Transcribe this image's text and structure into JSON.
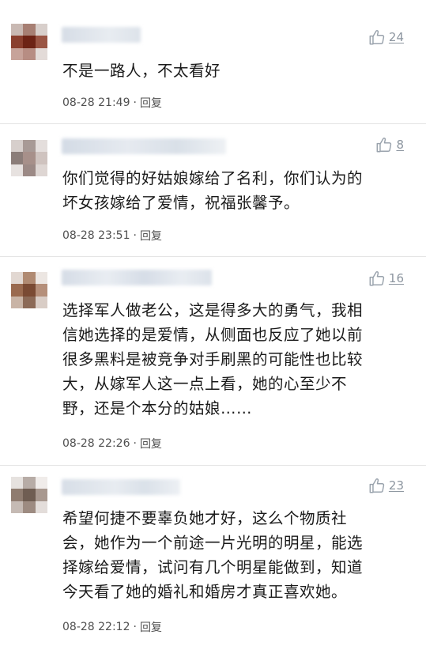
{
  "comments": [
    {
      "likes": "24",
      "text": "不是一路人，不太看好",
      "time": "08-28 21:49",
      "separator": "·",
      "reply_label": "回复"
    },
    {
      "likes": "8",
      "text": "你们觉得的好姑娘嫁给了名利，你们认为的\n坏女孩嫁给了爱情，祝福张馨予。",
      "time": "08-28 23:51",
      "separator": "·",
      "reply_label": "回复"
    },
    {
      "likes": "16",
      "text": "选择军人做老公，这是得多大的勇气，我相\n信她选择的是爱情，从侧面也反应了她以前\n很多黑料是被竞争对手刷黑的可能性也比较\n大，从嫁军人这一点上看，她的心至少不\n野，还是个本分的姑娘……",
      "time": "08-28 22:26",
      "separator": "·",
      "reply_label": "回复"
    },
    {
      "likes": "23",
      "text": "希望何捷不要辜负她才好，这么个物质社\n会，她作为一个前途一片光明的明星，能选\n择嫁给爱情，试问有几个明星能做到，知道\n今天看了她的婚礼和婚房才真正喜欢她。",
      "time": "08-28 22:12",
      "separator": "·",
      "reply_label": "回复"
    }
  ],
  "icons": {
    "like": "thumbs-up-icon"
  },
  "colors": {
    "like_icon": "#9aa3ad",
    "meta_text": "#505050",
    "divider": "#e4e4e4"
  }
}
